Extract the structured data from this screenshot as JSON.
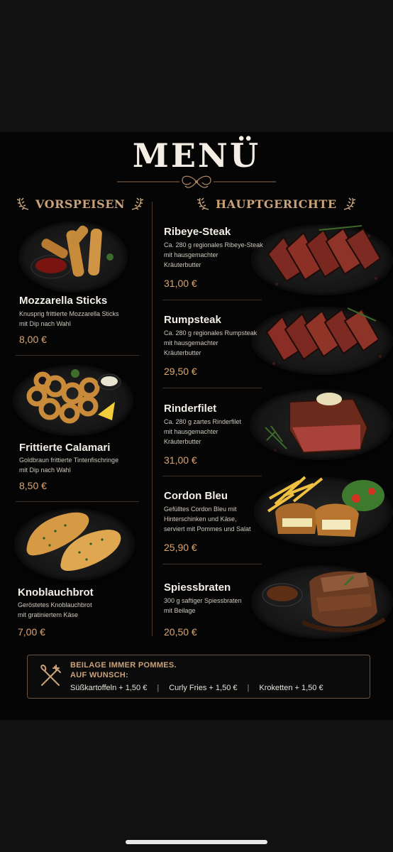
{
  "menu": {
    "title": "MENÜ",
    "sections": {
      "starters": "VORSPEISEN",
      "mains": "HAUPTGERICHTE"
    },
    "starters": [
      {
        "name": "Mozzarella Sticks",
        "desc": [
          "Knusprig frittierte Mozzarella Sticks",
          "mit Dip nach Wahl"
        ],
        "price": "8,00 €",
        "image": "mozzarella-sticks-photo"
      },
      {
        "name": "Frittierte Calamari",
        "desc": [
          "Goldbraun frittierte Tintenfischringe",
          "mit Dip nach Wahl"
        ],
        "price": "8,50 €",
        "image": "calamari-photo"
      },
      {
        "name": "Knoblauchbrot",
        "desc": [
          "Geröstetes Knoblauchbrot",
          "mit gratiniertem Käse"
        ],
        "price": "7,00 €",
        "image": "garlic-bread-photo"
      }
    ],
    "mains": [
      {
        "name": "Ribeye-Steak",
        "desc": [
          "Ca. 280 g regionales Ribeye-Steak",
          "mit hausgemachter",
          "Kräuterbutter"
        ],
        "price": "31,00 €",
        "image": "ribeye-photo"
      },
      {
        "name": "Rumpsteak",
        "desc": [
          "Ca. 280 g regionales Rumpsteak",
          "mit hausgemachter",
          "Kräuterbutter"
        ],
        "price": "29,50 €",
        "image": "rumpsteak-photo"
      },
      {
        "name": "Rinderfilet",
        "desc": [
          "Ca. 280 g zartes Rinderfilet",
          "mit hausgemachter",
          "Kräuterbutter"
        ],
        "price": "31,00 €",
        "image": "beef-fillet-photo"
      },
      {
        "name": "Cordon Bleu",
        "desc": [
          "Gefülltes Cordon Bleu mit",
          "Hinterschinken und Käse,",
          "serviert mit Pommes und Salat"
        ],
        "price": "25,90 €",
        "image": "cordon-bleu-photo"
      },
      {
        "name": "Spiessbraten",
        "desc": [
          "300 g saftiger Spiessbraten",
          "mit Beilage"
        ],
        "price": "20,50 €",
        "image": "roast-photo"
      }
    ],
    "footer": {
      "line1": "BEILAGE IMMER POMMES.",
      "line2": "AUF WUNSCH:",
      "extras": [
        "Süßkartoffeln + 1,50 €",
        "Curly Fries + 1,50 €",
        "Kroketten + 1,50 €"
      ],
      "separator": "|",
      "icon": "fork-knife-icon"
    },
    "colors": {
      "accent": "#c9a27a",
      "price": "#d9a673",
      "background": "#050505"
    }
  }
}
